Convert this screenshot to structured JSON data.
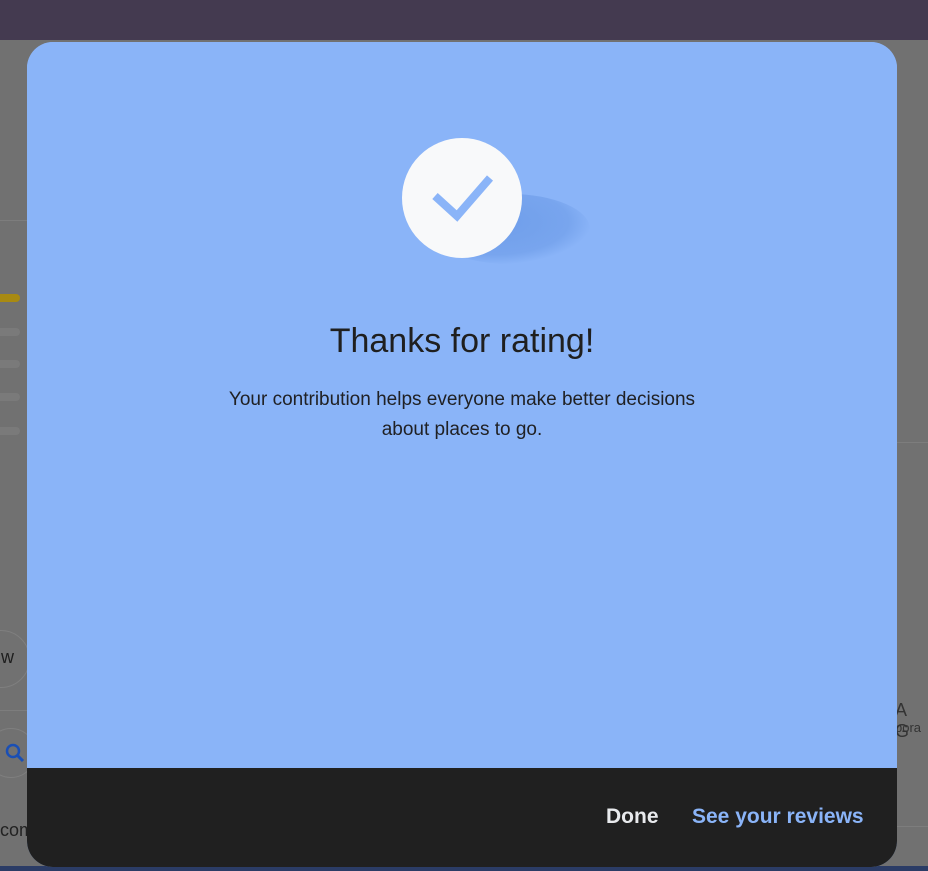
{
  "dialog": {
    "title": "Thanks for rating!",
    "message_line1": "Your contribution helps everyone make better decisions",
    "message_line2": "about places to go.",
    "done_label": "Done",
    "reviews_label": "See your reviews",
    "icon": "checkmark-icon"
  },
  "background_page": {
    "left_button_text": "w",
    "left_bottom_text": "com",
    "right_text": "A G",
    "right_subtext": "bora"
  },
  "colors": {
    "dialog_bg": "#8ab4f8",
    "footer_bg": "#202020",
    "accent": "#8ab4f8",
    "topbar": "#443a50"
  }
}
